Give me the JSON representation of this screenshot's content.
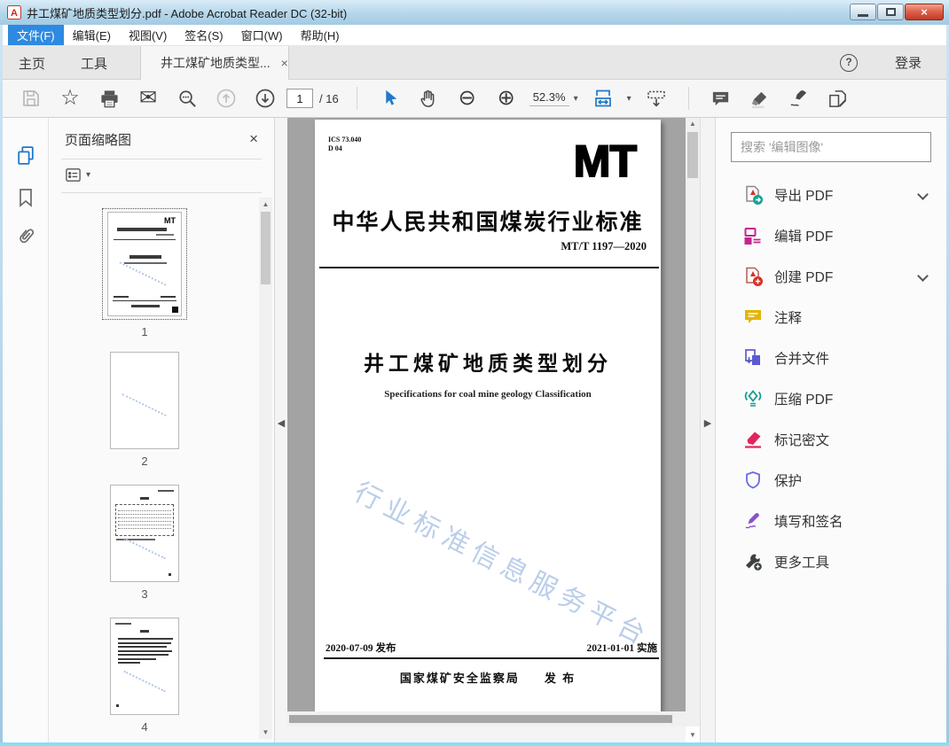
{
  "window": {
    "title": "井工煤矿地质类型划分.pdf - Adobe Acrobat Reader DC (32-bit)"
  },
  "icons": {
    "close": "×",
    "help": "?",
    "caret_down": "▾",
    "arrow_up": "▲",
    "arrow_down": "▼",
    "panel_left": "◀",
    "panel_right": "▶",
    "star": "☆",
    "envelope": "✉",
    "zoom_out": "⊖",
    "zoom_in": "⊕"
  },
  "menubar": {
    "items": [
      {
        "label": "文件(F)"
      },
      {
        "label": "编辑(E)"
      },
      {
        "label": "视图(V)"
      },
      {
        "label": "签名(S)"
      },
      {
        "label": "窗口(W)"
      },
      {
        "label": "帮助(H)"
      }
    ]
  },
  "tabbar": {
    "home": "主页",
    "tools": "工具",
    "document": "井工煤矿地质类型...",
    "login": "登录"
  },
  "toolbar": {
    "page_current": "1",
    "page_total": "/ 16",
    "zoom_level": "52.3%"
  },
  "left_panel": {
    "title": "页面缩略图",
    "thumbnails": [
      {
        "number": "1"
      },
      {
        "number": "2"
      },
      {
        "number": "3"
      },
      {
        "number": "4"
      }
    ]
  },
  "document": {
    "ics_line1": "ICS 73.040",
    "ics_line2": "D 04",
    "logo": "MT",
    "standard_heading": "中华人民共和国煤炭行业标准",
    "standard_number": "MT/T 1197—2020",
    "title": "井工煤矿地质类型划分",
    "subtitle": "Specifications for coal mine geology Classification",
    "watermark": "行业标准信息服务平台",
    "issue_date": "2020-07-09 发布",
    "implement_date": "2021-01-01 实施",
    "publisher": "国家煤矿安全监察局",
    "publish_label": "发 布"
  },
  "right_panel": {
    "search_placeholder": "搜索 '编辑图像'",
    "tools": [
      {
        "label": "导出 PDF",
        "chevron": true
      },
      {
        "label": "编辑 PDF",
        "chevron": false
      },
      {
        "label": "创建 PDF",
        "chevron": true
      },
      {
        "label": "注释",
        "chevron": false
      },
      {
        "label": "合并文件",
        "chevron": false
      },
      {
        "label": "压缩 PDF",
        "chevron": false
      },
      {
        "label": "标记密文",
        "chevron": false
      },
      {
        "label": "保护",
        "chevron": false
      },
      {
        "label": "填写和签名",
        "chevron": false
      },
      {
        "label": "更多工具",
        "chevron": false
      }
    ]
  },
  "colors": {
    "accent_blue": "#1e78c8",
    "menu_highlight": "#2e8ae0",
    "export_teal": "#16a293",
    "edit_magenta": "#c2258e",
    "create_red": "#d93025",
    "comment_yellow": "#e3b505",
    "combine_purple": "#5a5ad1",
    "compress_teal": "#1b9e93",
    "redact_pink": "#e0265e",
    "protect_indigo": "#6b6be0",
    "sign_purple": "#8a52cc",
    "more_dark": "#3d4043"
  }
}
